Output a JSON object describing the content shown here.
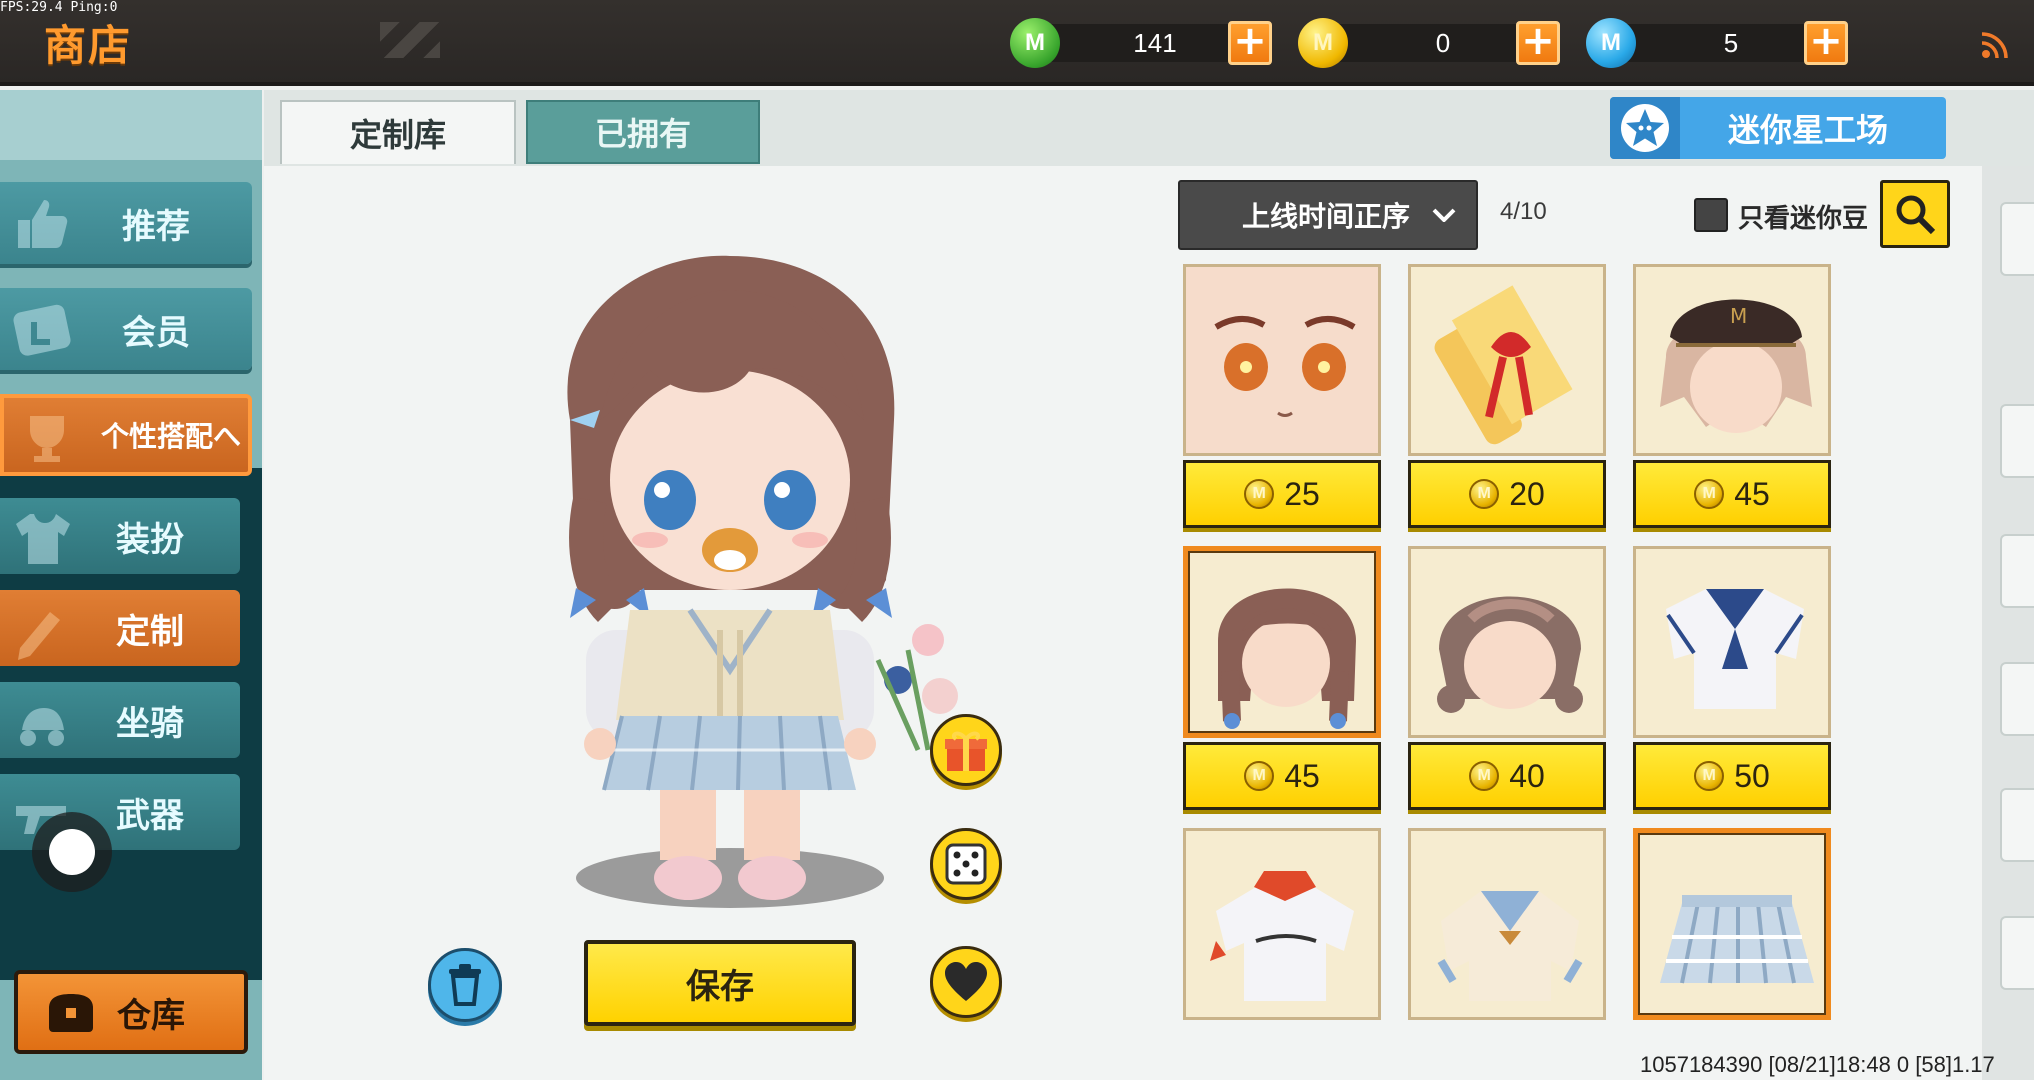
{
  "debug": {
    "fps_text": "FPS:29.4  Ping:0"
  },
  "header": {
    "title": "商店",
    "currencies": [
      {
        "name": "mini-bean",
        "icon": "green-m-coin-icon",
        "amount": "141",
        "coin_letter": "M"
      },
      {
        "name": "mini-coin",
        "icon": "gold-m-coin-icon",
        "amount": "0",
        "coin_letter": "M"
      },
      {
        "name": "mini-point",
        "icon": "blue-m-coin-icon",
        "amount": "5",
        "coin_letter": "M"
      }
    ],
    "plus_label": "+"
  },
  "sidebar": {
    "items": [
      {
        "label": "推荐",
        "icon": "thumbs-up-icon"
      },
      {
        "label": "会员",
        "icon": "member-card-icon"
      },
      {
        "label": "个性搭配へ",
        "icon": "trophy-icon"
      },
      {
        "label": "装扮",
        "icon": "shirt-icon"
      },
      {
        "label": "定制",
        "icon": "pencil-icon"
      },
      {
        "label": "坐骑",
        "icon": "mount-icon"
      },
      {
        "label": "武器",
        "icon": "gun-icon"
      }
    ],
    "warehouse_label": "仓库"
  },
  "tabs": [
    {
      "label": "定制库"
    },
    {
      "label": "已拥有"
    }
  ],
  "workshop_label": "迷你星工场",
  "toolbar": {
    "sort_label": "上线时间正序",
    "page_count": "4/10",
    "filter_label": "只看迷你豆"
  },
  "items": [
    {
      "name": "face",
      "price": "25",
      "coin_letter": "M"
    },
    {
      "name": "scroll",
      "price": "20",
      "coin_letter": "M"
    },
    {
      "name": "cap-hair",
      "price": "45",
      "coin_letter": "M"
    },
    {
      "name": "braided-hair",
      "price": "45",
      "coin_letter": "M",
      "selected": true
    },
    {
      "name": "braid-bun-hair",
      "price": "40",
      "coin_letter": "M"
    },
    {
      "name": "sailor-shirt",
      "price": "50",
      "coin_letter": "M"
    },
    {
      "name": "sport-shirt",
      "price": "",
      "coin_letter": "M"
    },
    {
      "name": "school-cardigan",
      "price": "",
      "coin_letter": "M"
    },
    {
      "name": "plaid-skirt",
      "price": "",
      "coin_letter": "M",
      "selected": true
    }
  ],
  "save_label": "保存",
  "footer": {
    "id_text": "1057184390    [08/21]18:48 0    [58]1.17"
  },
  "colors": {
    "accent_orange": "#f08a1e",
    "button_yellow": "#ffd51a",
    "teal": "#5a9e9a",
    "workshop_blue": "#44a6e8"
  }
}
